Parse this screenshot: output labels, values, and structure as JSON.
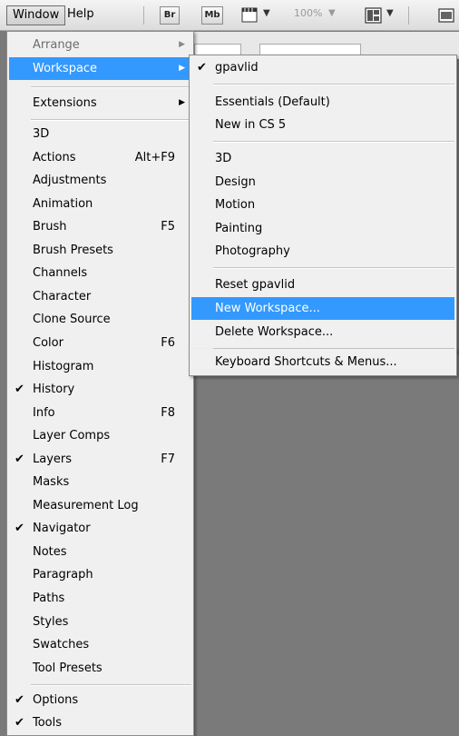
{
  "menubar": {
    "window_label": "Window",
    "help_label": "Help",
    "bridge_label": "Br",
    "minibridge_label": "Mb",
    "zoom_value": "100%"
  },
  "main_menu": {
    "arrange": "Arrange",
    "workspace": "Workspace",
    "extensions": "Extensions",
    "items": [
      {
        "label": "3D",
        "shortcut": "",
        "checked": false
      },
      {
        "label": "Actions",
        "shortcut": "Alt+F9",
        "checked": false
      },
      {
        "label": "Adjustments",
        "shortcut": "",
        "checked": false
      },
      {
        "label": "Animation",
        "shortcut": "",
        "checked": false
      },
      {
        "label": "Brush",
        "shortcut": "F5",
        "checked": false
      },
      {
        "label": "Brush Presets",
        "shortcut": "",
        "checked": false
      },
      {
        "label": "Channels",
        "shortcut": "",
        "checked": false
      },
      {
        "label": "Character",
        "shortcut": "",
        "checked": false
      },
      {
        "label": "Clone Source",
        "shortcut": "",
        "checked": false
      },
      {
        "label": "Color",
        "shortcut": "F6",
        "checked": false
      },
      {
        "label": "Histogram",
        "shortcut": "",
        "checked": false
      },
      {
        "label": "History",
        "shortcut": "",
        "checked": true
      },
      {
        "label": "Info",
        "shortcut": "F8",
        "checked": false
      },
      {
        "label": "Layer Comps",
        "shortcut": "",
        "checked": false
      },
      {
        "label": "Layers",
        "shortcut": "F7",
        "checked": true
      },
      {
        "label": "Masks",
        "shortcut": "",
        "checked": false
      },
      {
        "label": "Measurement Log",
        "shortcut": "",
        "checked": false
      },
      {
        "label": "Navigator",
        "shortcut": "",
        "checked": true
      },
      {
        "label": "Notes",
        "shortcut": "",
        "checked": false
      },
      {
        "label": "Paragraph",
        "shortcut": "",
        "checked": false
      },
      {
        "label": "Paths",
        "shortcut": "",
        "checked": false
      },
      {
        "label": "Styles",
        "shortcut": "",
        "checked": false
      },
      {
        "label": "Swatches",
        "shortcut": "",
        "checked": false
      },
      {
        "label": "Tool Presets",
        "shortcut": "",
        "checked": false
      }
    ],
    "bottom_items": [
      {
        "label": "Options",
        "checked": true
      },
      {
        "label": "Tools",
        "checked": true
      }
    ]
  },
  "workspace_menu": {
    "current": "gpavlid",
    "essentials": "Essentials (Default)",
    "new_in_cs5": "New in CS 5",
    "presets": [
      "3D",
      "Design",
      "Motion",
      "Painting",
      "Photography"
    ],
    "reset": "Reset gpavlid",
    "new_workspace": "New Workspace...",
    "delete_workspace": "Delete Workspace...",
    "shortcuts": "Keyboard Shortcuts & Menus..."
  },
  "glyphs": {
    "check": "✔",
    "submenu_arrow": "▶",
    "dropdown_arrow": "▼"
  }
}
